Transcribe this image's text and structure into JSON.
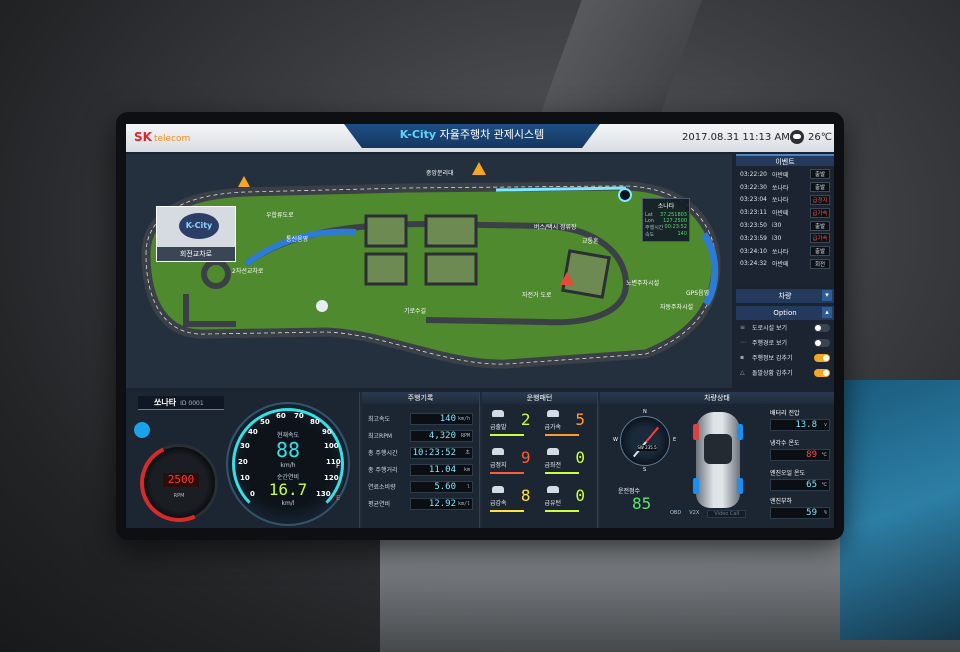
{
  "header": {
    "logo_brand": "SK",
    "logo_sub": "telecom",
    "title_accent": "K-City",
    "title_rest": " 자율주행차 관제시스템",
    "datetime": "2017.08.31  11:13 AM",
    "temperature": "26℃"
  },
  "map": {
    "rotary_label": "회전교차로",
    "rotary_logo": "K-City",
    "labels": {
      "l1": "중앙분리대",
      "l2": "우합류도로",
      "l3": "통신음영",
      "l4": "2차선교차로",
      "l5": "버스/택시 정류장",
      "l6": "교통혼",
      "l7": "자전거 도로",
      "l8": "노변주차시설",
      "l9": "GPS음영",
      "l10": "자동주차시설",
      "l11": "기로수길"
    },
    "popup": {
      "title": "소나타",
      "rows": [
        {
          "k": "Lat",
          "v": "37.251803"
        },
        {
          "k": "Lon",
          "v": "127.2500"
        },
        {
          "k": "주행시간",
          "v": "00:23:52"
        },
        {
          "k": "속도",
          "v": "140"
        }
      ]
    }
  },
  "events": {
    "header": "이벤트",
    "items": [
      {
        "time": "03:22:20",
        "name": "아반떼",
        "status": "출발",
        "alert": false
      },
      {
        "time": "03:22:30",
        "name": "쏘나타",
        "status": "출발",
        "alert": false
      },
      {
        "time": "03:23:04",
        "name": "쏘나타",
        "status": "급정지",
        "alert": true
      },
      {
        "time": "03:23:11",
        "name": "아반떼",
        "status": "급가속",
        "alert": true
      },
      {
        "time": "03:23:50",
        "name": "i30",
        "status": "출발",
        "alert": false
      },
      {
        "time": "03:23:59",
        "name": "i30",
        "status": "급가속",
        "alert": true
      },
      {
        "time": "03:24:10",
        "name": "쏘나타",
        "status": "출발",
        "alert": false
      },
      {
        "time": "03:24:32",
        "name": "아반떼",
        "status": "회전",
        "alert": false
      }
    ]
  },
  "vehicle_dropdown": "차량",
  "options": {
    "header": "Option",
    "items": [
      {
        "label": "도로시설 보기",
        "on": false
      },
      {
        "label": "주행경로 보기",
        "on": false
      },
      {
        "label": "주행정보 감추기",
        "on": true
      },
      {
        "label": "돌발상황 감추기",
        "on": true
      }
    ]
  },
  "vehicle": {
    "name": "쏘나타",
    "id": "ID 0001",
    "rpm": "2500",
    "rpm_unit": "RPM",
    "speed_caption": "현재속도",
    "speed": "88",
    "speed_unit": "km/h",
    "fuel_caption": "순간연비",
    "fuel_eff": "16.7",
    "fuel_unit": "km/l",
    "speed_ticks": [
      "0",
      "10",
      "20",
      "30",
      "40",
      "50",
      "60",
      "70",
      "80",
      "90",
      "100",
      "110",
      "120",
      "130"
    ],
    "fuel_full": "F",
    "fuel_empty": "E"
  },
  "driving_record": {
    "header": "주행기록",
    "rows": [
      {
        "label": "최고속도",
        "value": "140",
        "unit": "km/h"
      },
      {
        "label": "최고RPM",
        "value": "4,320",
        "unit": "RPM"
      },
      {
        "label": "총 주행시간",
        "value": "10:23:52",
        "unit": "초"
      },
      {
        "label": "총 주행거리",
        "value": "11.04",
        "unit": "km"
      },
      {
        "label": "연료소비량",
        "value": "5.60",
        "unit": "l"
      },
      {
        "label": "평균연비",
        "value": "12.92",
        "unit": "km/l"
      }
    ]
  },
  "driving_pattern": {
    "header": "운행패턴",
    "items": [
      {
        "label": "급출발",
        "value": "2",
        "color": "#c9ff3f"
      },
      {
        "label": "급가속",
        "value": "5",
        "color": "#ff9a2e"
      },
      {
        "label": "급정지",
        "value": "9",
        "color": "#ff5a3a"
      },
      {
        "label": "급좌전",
        "value": "0",
        "color": "#c9ff3f"
      },
      {
        "label": "급감속",
        "value": "8",
        "color": "#ffe13f"
      },
      {
        "label": "급유턴",
        "value": "0",
        "color": "#c9ff3f"
      }
    ]
  },
  "vehicle_status": {
    "header": "차량상태",
    "compass": {
      "n": "N",
      "s": "S",
      "e": "E",
      "w": "W",
      "readout": "SW 235.5"
    },
    "drive_score_label": "운전점수",
    "drive_score": "85",
    "tags": [
      "OBD",
      "V2X",
      "Video Call"
    ],
    "battery_label": "배터리 전압",
    "battery": "13.8",
    "battery_unit": "v",
    "coolant_label": "냉각수 온도",
    "coolant": "89",
    "coolant_unit": "℃",
    "oil_label": "엔진오일 온도",
    "oil": "65",
    "oil_unit": "℃",
    "load_label": "엔진부하",
    "load": "59",
    "load_unit": "%"
  },
  "colors": {
    "accent_cyan": "#35e0e6",
    "alert_red": "#ff4a4a",
    "toggle_on": "#f5a623",
    "header_blue": "#1f4e84"
  }
}
